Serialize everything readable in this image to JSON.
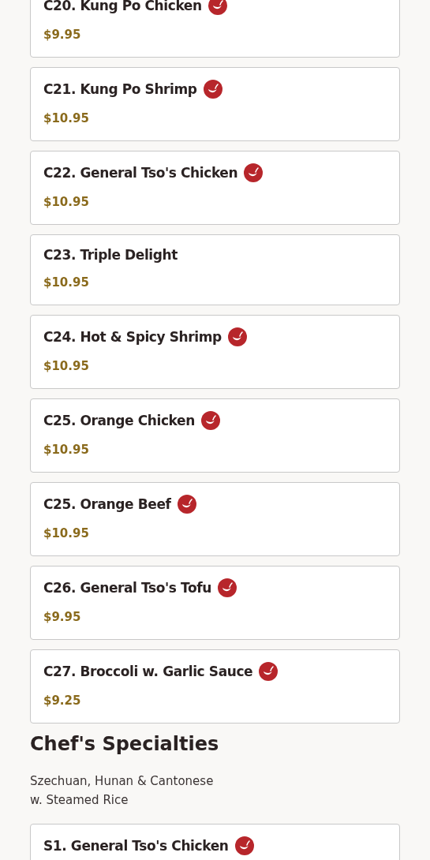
{
  "items": [
    {
      "name": "C20. Kung Po Chicken",
      "price": "$9.95",
      "spicy": true
    },
    {
      "name": "C21. Kung Po Shrimp",
      "price": "$10.95",
      "spicy": true
    },
    {
      "name": "C22. General Tso's Chicken",
      "price": "$10.95",
      "spicy": true
    },
    {
      "name": "C23. Triple Delight",
      "price": "$10.95",
      "spicy": false
    },
    {
      "name": "C24. Hot & Spicy Shrimp",
      "price": "$10.95",
      "spicy": true
    },
    {
      "name": "C25. Orange Chicken",
      "price": "$10.95",
      "spicy": true
    },
    {
      "name": "C25. Orange Beef",
      "price": "$10.95",
      "spicy": true
    },
    {
      "name": "C26. General Tso's Tofu",
      "price": "$9.95",
      "spicy": true
    },
    {
      "name": "C27. Broccoli w. Garlic Sauce",
      "price": "$9.25",
      "spicy": true
    }
  ],
  "section": {
    "title": "Chef's Specialties",
    "description": [
      "Szechuan, Hunan & Cantonese",
      "w. Steamed Rice"
    ],
    "items": [
      {
        "name": "S1. General Tso's Chicken",
        "spicy": true
      }
    ]
  }
}
